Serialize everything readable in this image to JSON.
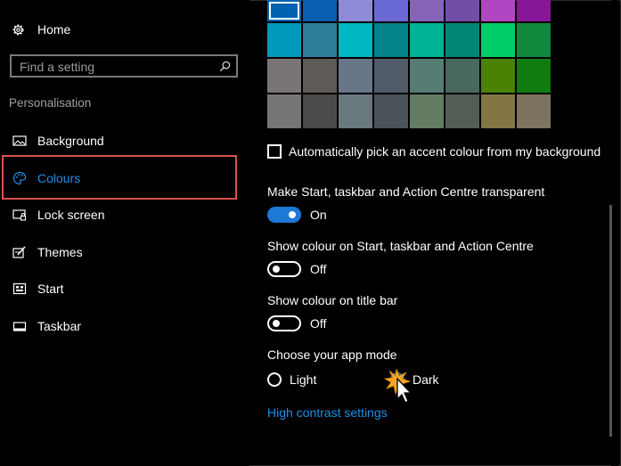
{
  "sidebar": {
    "home_label": "Home",
    "search_placeholder": "Find a setting",
    "section_title": "Personalisation",
    "items": [
      {
        "label": "Background",
        "icon": "picture-icon"
      },
      {
        "label": "Colours",
        "icon": "palette-icon",
        "active": true
      },
      {
        "label": "Lock screen",
        "icon": "lock-screen-icon"
      },
      {
        "label": "Themes",
        "icon": "themes-icon"
      },
      {
        "label": "Start",
        "icon": "start-icon"
      },
      {
        "label": "Taskbar",
        "icon": "taskbar-icon"
      }
    ]
  },
  "swatches": [
    [
      "#0063b1",
      "#0a5fb3",
      "#8e8cd8",
      "#6b69d6",
      "#8764b8",
      "#744da9",
      "#b146c2",
      "#881798"
    ],
    [
      "#0099bc",
      "#2d7d9a",
      "#00b7c3",
      "#038387",
      "#00b294",
      "#018574",
      "#00cc6a",
      "#10893e"
    ],
    [
      "#7a7574",
      "#5d5a58",
      "#68768a",
      "#515c6b",
      "#567c73",
      "#486860",
      "#498205",
      "#107c10"
    ],
    [
      "#767676",
      "#4c4a48",
      "#69797e",
      "#4a5459",
      "#647c64",
      "#525e54",
      "#847545",
      "#7e735f"
    ]
  ],
  "accent_auto_label": "Automatically pick an accent colour from my background",
  "transparency": {
    "label": "Make Start, taskbar and Action Centre transparent",
    "state": "On"
  },
  "colour_start": {
    "label": "Show colour on Start, taskbar and Action Centre",
    "state": "Off"
  },
  "colour_title": {
    "label": "Show colour on title bar",
    "state": "Off"
  },
  "app_mode": {
    "label": "Choose your app mode",
    "light": "Light",
    "dark": "Dark",
    "selected": "Dark"
  },
  "high_contrast_link": "High contrast settings",
  "colors": {
    "accent": "#1e78d6",
    "highlight_box": "#d9534a"
  }
}
